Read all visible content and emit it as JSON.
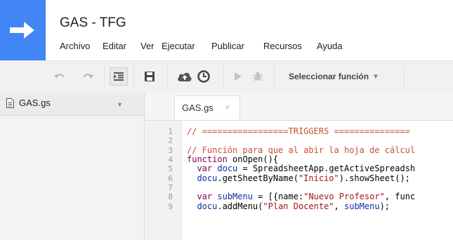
{
  "header": {
    "title": "GAS - TFG",
    "menu": [
      "Archivo",
      "Editar",
      "Ver",
      "Ejecutar",
      "Publicar",
      "Recursos",
      "Ayuda"
    ]
  },
  "toolbar": {
    "function_select": "Seleccionar función",
    "icons": [
      "undo-icon",
      "redo-icon",
      "indent-icon",
      "save-icon",
      "cloud-upload-icon",
      "clock-trigger-icon",
      "run-icon",
      "debug-bug-icon"
    ]
  },
  "files": {
    "items": [
      {
        "name": "GAS.gs"
      }
    ]
  },
  "tabs": [
    {
      "label": "GAS.gs",
      "close": "×"
    }
  ],
  "editor": {
    "line_numbers": [
      "1",
      "2",
      "3",
      "4",
      "5",
      "6",
      "7",
      "8",
      "9"
    ],
    "lines": [
      [
        {
          "t": "// =================TRIGGERS ===============",
          "c": "cm"
        }
      ],
      [],
      [
        {
          "t": "// Función para que al abir la hoja de cálcul",
          "c": "cm"
        }
      ],
      [
        {
          "t": "function",
          "c": "kw"
        },
        {
          "t": " onOpen(){",
          "c": ""
        }
      ],
      [
        {
          "t": "  ",
          "c": ""
        },
        {
          "t": "var",
          "c": "kw"
        },
        {
          "t": " ",
          "c": ""
        },
        {
          "t": "docu",
          "c": "vr"
        },
        {
          "t": " = SpreadsheetApp.getActiveSpreadsh",
          "c": ""
        }
      ],
      [
        {
          "t": "  ",
          "c": ""
        },
        {
          "t": "docu",
          "c": "vr"
        },
        {
          "t": ".getSheetByName(",
          "c": ""
        },
        {
          "t": "\"Inicio\"",
          "c": "str"
        },
        {
          "t": ").showSheet();",
          "c": ""
        }
      ],
      [],
      [
        {
          "t": "  ",
          "c": ""
        },
        {
          "t": "var",
          "c": "kw"
        },
        {
          "t": " ",
          "c": ""
        },
        {
          "t": "subMenu",
          "c": "vr"
        },
        {
          "t": " = [{name:",
          "c": ""
        },
        {
          "t": "\"Nuevo Profesor\"",
          "c": "str"
        },
        {
          "t": ", func",
          "c": ""
        }
      ],
      [
        {
          "t": "  ",
          "c": ""
        },
        {
          "t": "docu",
          "c": "vr"
        },
        {
          "t": ".addMenu(",
          "c": ""
        },
        {
          "t": "\"Plan Docente\"",
          "c": "str"
        },
        {
          "t": ", ",
          "c": ""
        },
        {
          "t": "subMenu",
          "c": "vr"
        },
        {
          "t": ");",
          "c": ""
        }
      ]
    ]
  }
}
